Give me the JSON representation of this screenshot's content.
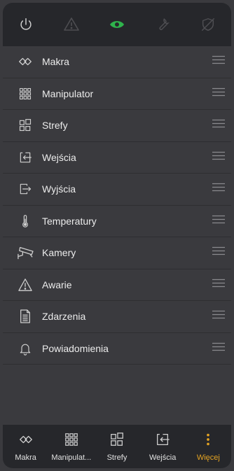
{
  "colors": {
    "background": "#3a3a3e",
    "bar": "#26272b",
    "icon": "#d0d0d0",
    "icon_disabled": "#4e4e52",
    "accent_green": "#2fb34c",
    "accent_orange": "#e5a322"
  },
  "topbar": {
    "icons": [
      "power-icon",
      "warning-icon",
      "eye-icon",
      "wrench-icon",
      "shield-off-icon"
    ]
  },
  "menu": {
    "items": [
      {
        "label": "Makra",
        "icon": "makra-icon"
      },
      {
        "label": "Manipulator",
        "icon": "keypad-icon"
      },
      {
        "label": "Strefy",
        "icon": "zones-icon"
      },
      {
        "label": "Wejścia",
        "icon": "input-icon"
      },
      {
        "label": "Wyjścia",
        "icon": "output-icon"
      },
      {
        "label": "Temperatury",
        "icon": "thermometer-icon"
      },
      {
        "label": "Kamery",
        "icon": "camera-icon"
      },
      {
        "label": "Awarie",
        "icon": "warning-icon"
      },
      {
        "label": "Zdarzenia",
        "icon": "document-icon"
      },
      {
        "label": "Powiadomienia",
        "icon": "bell-icon"
      }
    ]
  },
  "bottom_nav": {
    "tabs": [
      {
        "label": "Makra",
        "icon": "makra-icon"
      },
      {
        "label": "Manipulat...",
        "icon": "keypad-icon"
      },
      {
        "label": "Strefy",
        "icon": "zones-icon"
      },
      {
        "label": "Wejścia",
        "icon": "input-icon"
      },
      {
        "label": "Więcej",
        "icon": "more-vert-icon",
        "active": true
      }
    ]
  }
}
